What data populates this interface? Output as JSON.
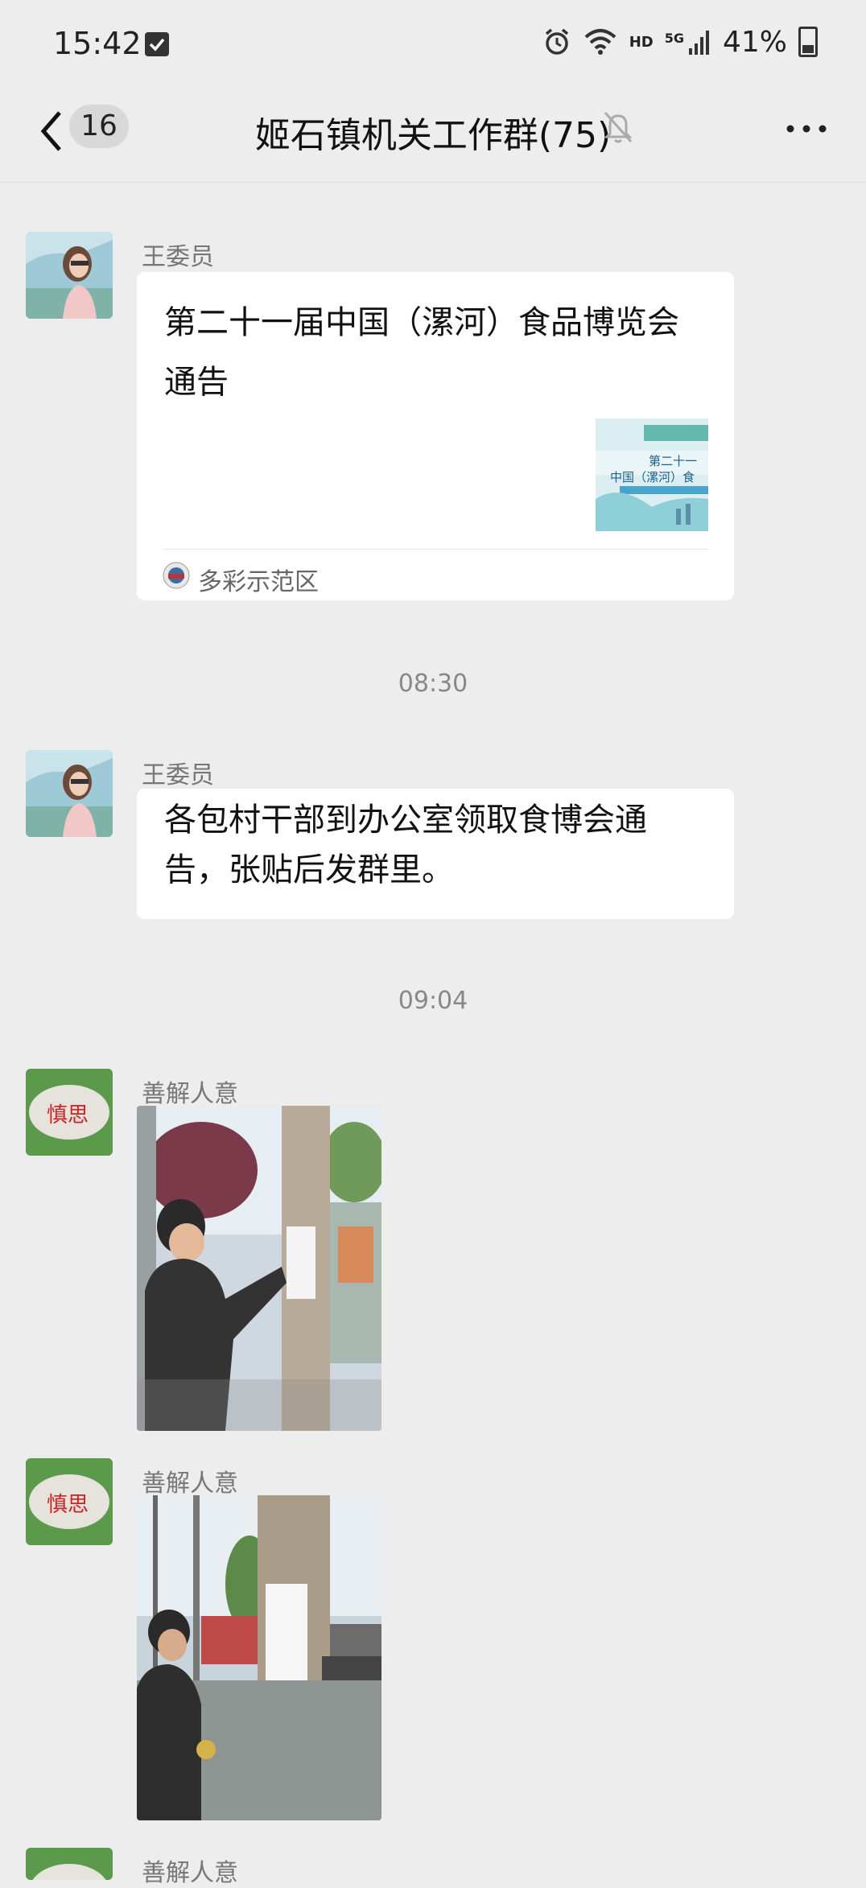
{
  "status_bar": {
    "time": "15:42",
    "hd": "HD",
    "network": "5G",
    "battery": "41%",
    "icons": [
      "checkbox-icon",
      "alarm-icon",
      "wifi-icon",
      "signal-icon",
      "battery-icon"
    ]
  },
  "header": {
    "unread_count": "16",
    "title": "姬石镇机关工作群(75)",
    "icons": [
      "back-chevron-icon",
      "mute-bell-icon",
      "more-dots-icon"
    ]
  },
  "messages": [
    {
      "sender": "王委员",
      "type": "link-card",
      "title": "第二十一届中国（漯河）食品博览会通告",
      "source": "多彩示范区"
    },
    {
      "sender": "王委员",
      "type": "text",
      "text": "各包村干部到办公室领取食博会通告，张贴后发群里。"
    },
    {
      "sender": "善解人意",
      "type": "image"
    },
    {
      "sender": "善解人意",
      "type": "image"
    },
    {
      "sender": "善解人意",
      "type": "image"
    }
  ],
  "timestamps": [
    "08:30",
    "09:04"
  ],
  "colors": {
    "background": "#ededed",
    "bubble": "#ffffff",
    "secondary_text": "#888888"
  }
}
